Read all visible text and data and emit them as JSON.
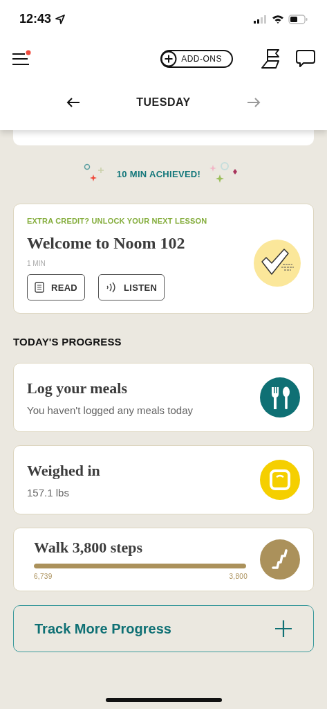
{
  "status_bar": {
    "time": "12:43"
  },
  "header": {
    "menu_notification": true,
    "addons_label": "ADD-ONS"
  },
  "day_nav": {
    "day": "TUESDAY",
    "prev_disabled": false,
    "next_disabled": true
  },
  "achievement": {
    "text": "10 MIN ACHIEVED!"
  },
  "lesson": {
    "eyebrow": "EXTRA CREDIT? UNLOCK YOUR NEXT LESSON",
    "title": "Welcome to Noom 102",
    "duration": "1 MIN",
    "buttons": [
      {
        "kind": "read",
        "label": "READ"
      },
      {
        "kind": "listen",
        "label": "LISTEN"
      }
    ]
  },
  "progress": {
    "heading": "TODAY'S PROGRESS",
    "items": [
      {
        "kind": "meals",
        "title": "Log your meals",
        "subtitle": "You haven't logged any meals today"
      },
      {
        "kind": "weight",
        "title": "Weighed in",
        "subtitle": "157.1 lbs"
      },
      {
        "kind": "steps",
        "title": "Walk 3,800 steps",
        "level": 1,
        "current": "6,739",
        "goal": "3,800"
      }
    ]
  },
  "track_more": {
    "label": "Track More Progress"
  }
}
